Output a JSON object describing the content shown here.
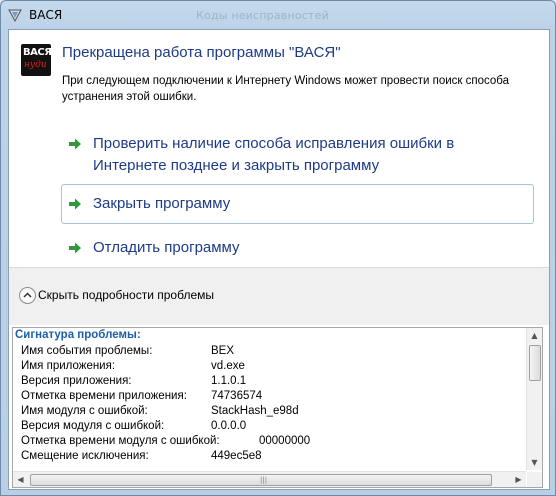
{
  "window": {
    "title": "ВАСЯ",
    "ghost_title": "Коды неисправностей"
  },
  "logo": {
    "top": "ВАСЯ",
    "bottom": "нуди"
  },
  "header": {
    "heading": "Прекращена работа программы \"ВАСЯ\"",
    "description": "При следующем подключении к Интернету Windows может провести поиск способа устранения этой ошибки."
  },
  "commands": [
    {
      "label_line1": "Проверить наличие способа исправления ошибки в",
      "label_line2": "Интернете позднее и закрыть программу"
    },
    {
      "label": "Закрыть программу"
    },
    {
      "label": "Отладить программу"
    }
  ],
  "details_toggle": {
    "label": "Скрыть подробности проблемы"
  },
  "problem": {
    "heading": "Сигнатура проблемы:",
    "rows": [
      {
        "key": "Имя события проблемы:",
        "value": "BEX"
      },
      {
        "key": "Имя приложения:",
        "value": "vd.exe"
      },
      {
        "key": "Версия приложения:",
        "value": "1.1.0.1"
      },
      {
        "key": "Отметка времени приложения:",
        "value": "74736574"
      },
      {
        "key": "Имя модуля с ошибкой:",
        "value": "StackHash_e98d"
      },
      {
        "key": "Версия модуля с ошибкой:",
        "value": "0.0.0.0"
      },
      {
        "key": "Отметка времени модуля с ошибкой:",
        "value": "00000000"
      },
      {
        "key": "Смещение исключения:",
        "value": "449ec5e8"
      }
    ]
  },
  "colors": {
    "link": "#1e3b87",
    "arrow": "#2e9a3a",
    "heading_blue": "#1c5fa8"
  }
}
